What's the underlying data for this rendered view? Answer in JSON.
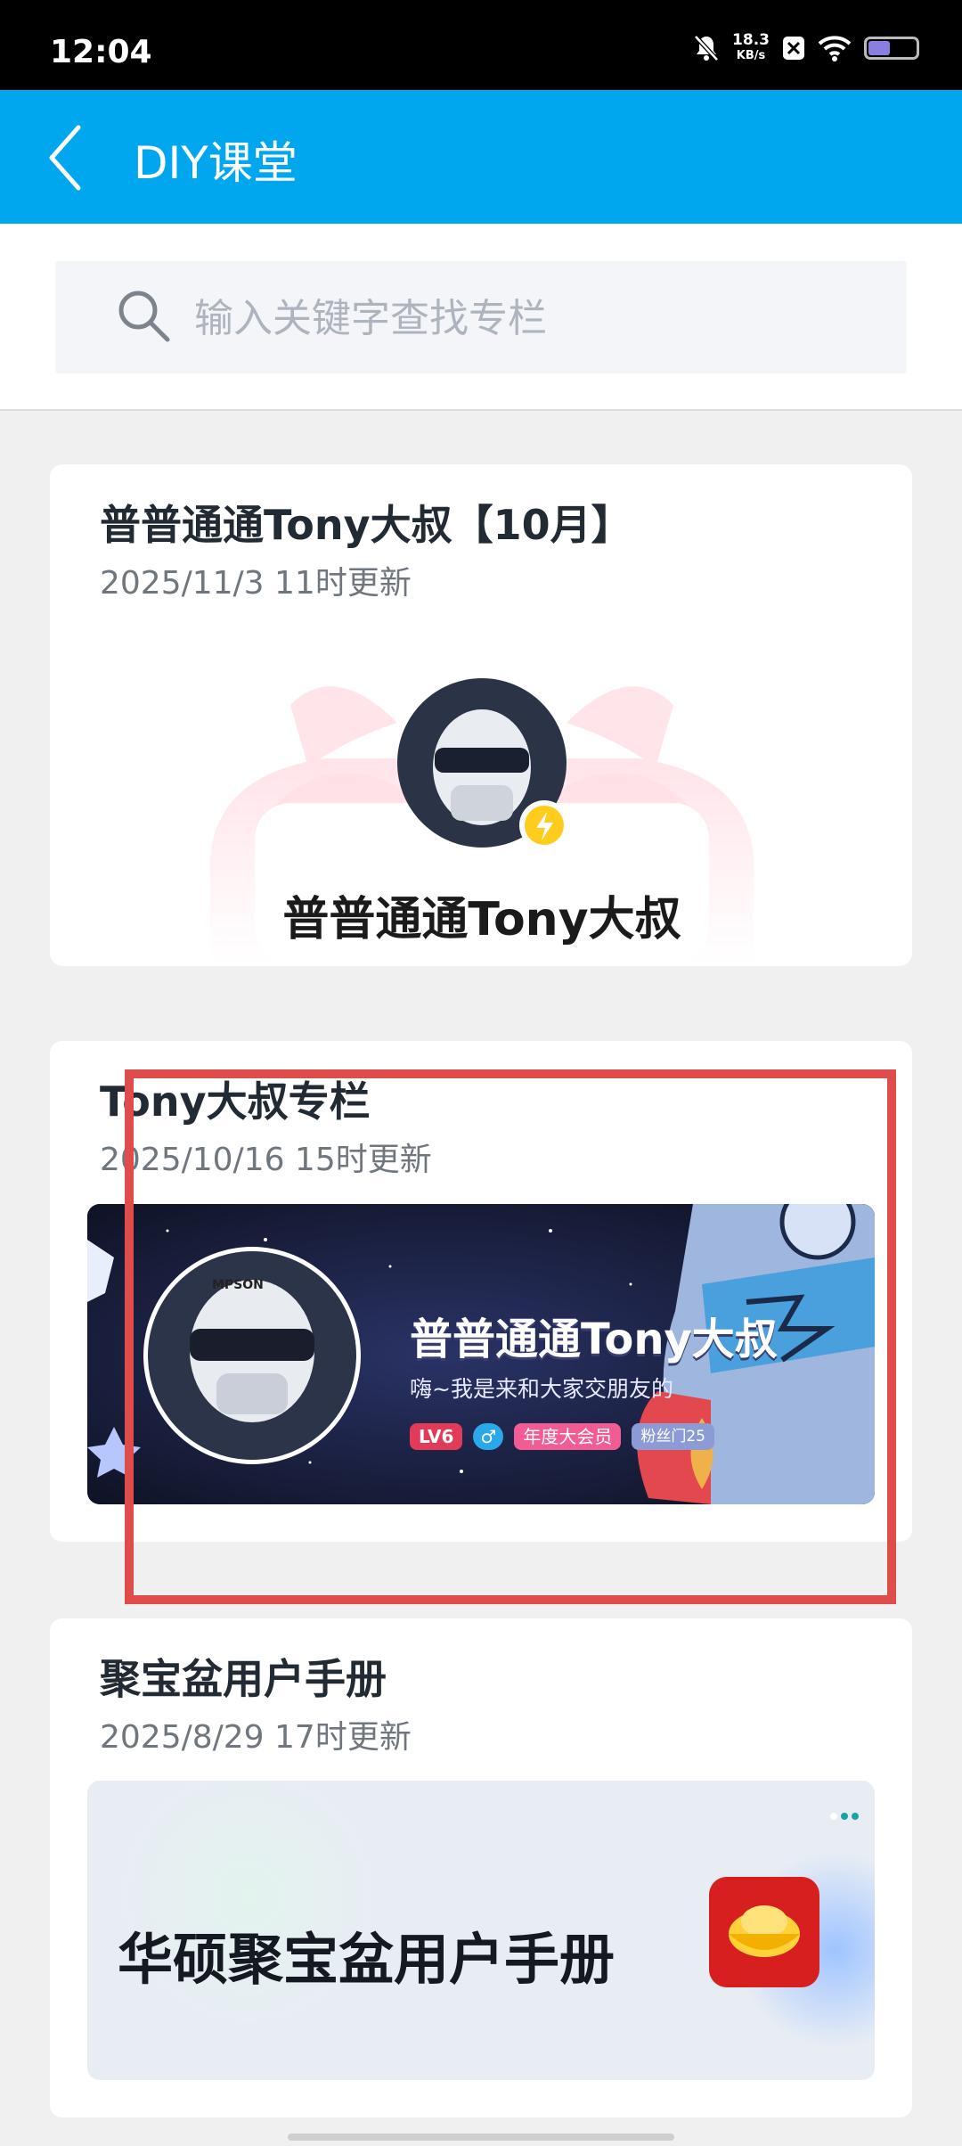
{
  "status_bar": {
    "time": "12:04",
    "speed_value": "18.3",
    "speed_unit": "KB/s"
  },
  "app_bar": {
    "title": "DIY课堂",
    "back_icon": "chevron-left-icon"
  },
  "search": {
    "placeholder": "输入关键字查找专栏",
    "icon": "search-icon"
  },
  "columns": [
    {
      "title": "普普通通Tony大叔【10月】",
      "updated": "2025/11/3 11时更新",
      "cover_name": "普普通通Tony大叔"
    },
    {
      "title": "Tony大叔专栏",
      "updated": "2025/10/16 15时更新",
      "banner": {
        "name": "普普通通Tony大叔",
        "bio": "嗨~我是来和大家交朋友的",
        "level": "LV6",
        "gender": "♂",
        "member": "年度大会员",
        "fans": "粉丝门25"
      }
    },
    {
      "title": "聚宝盆用户手册",
      "updated": "2025/8/29 17时更新",
      "banner_title": "华硕聚宝盆用户手册"
    }
  ],
  "colors": {
    "app_bar": "#00a7ee",
    "highlight": "#e04b4b"
  }
}
